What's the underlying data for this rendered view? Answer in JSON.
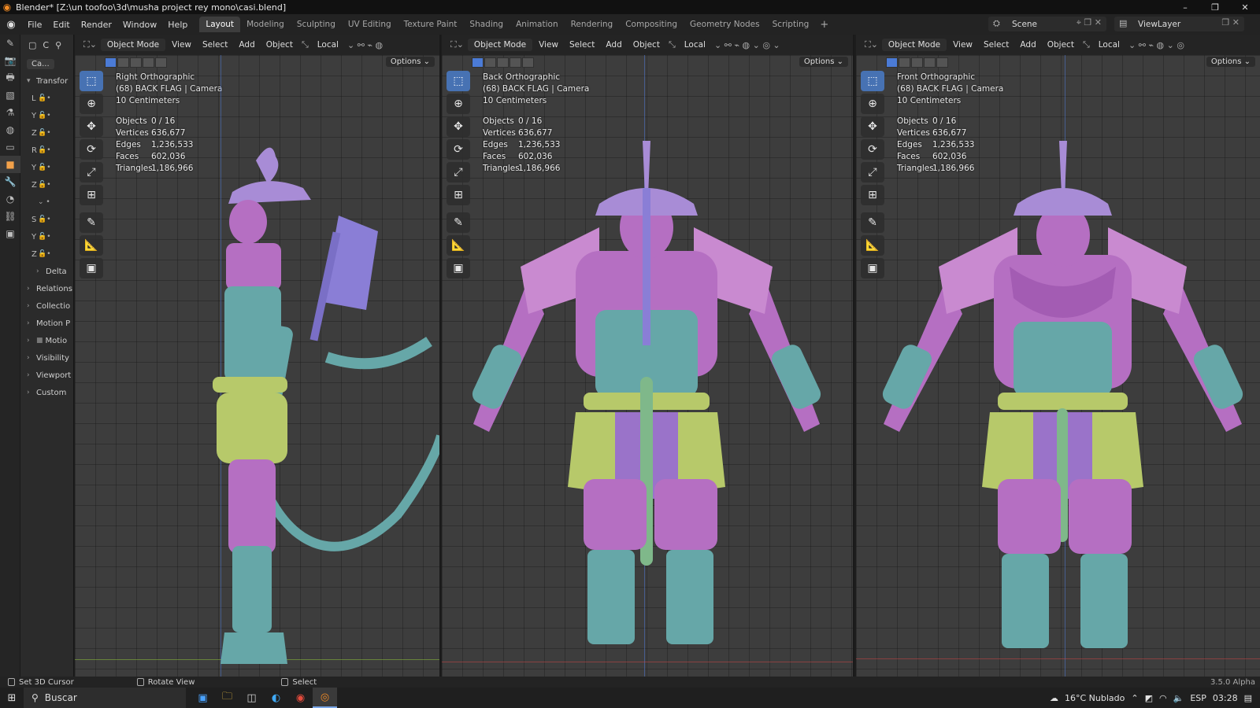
{
  "window": {
    "title": "Blender* [Z:\\un toofoo\\3d\\musha project rey mono\\casi.blend]",
    "controls": [
      "–",
      "❐",
      "✕"
    ]
  },
  "menu": {
    "items": [
      "File",
      "Edit",
      "Render",
      "Window",
      "Help"
    ],
    "workspaces": [
      "Layout",
      "Modeling",
      "Sculpting",
      "UV Editing",
      "Texture Paint",
      "Shading",
      "Animation",
      "Rendering",
      "Compositing",
      "Geometry Nodes",
      "Scripting"
    ],
    "active_workspace": "Layout",
    "add_label": "+"
  },
  "scene": {
    "label": "Scene"
  },
  "view_layer": {
    "label": "ViewLayer"
  },
  "properties": {
    "header_label": "C",
    "object_name": "Ca...",
    "transform_label": "Transfor",
    "location_axes": [
      "L",
      "Y",
      "Z"
    ],
    "rotation_axes": [
      "R",
      "Y",
      "Z"
    ],
    "scale_axes": [
      "S",
      "Y",
      "Z"
    ],
    "sections": [
      "Delta",
      "Relations",
      "Collectio",
      "Motion P",
      "Motio",
      "Visibility",
      "Viewport",
      "Custom"
    ]
  },
  "viewport_header": {
    "mode": "Object Mode",
    "menus": [
      "View",
      "Select",
      "Add",
      "Object"
    ],
    "orientation": "Local",
    "options": "Options"
  },
  "viewports": [
    {
      "view_name": "Right Orthographic",
      "collection": "(68) BACK FLAG | Camera",
      "scale": "10 Centimeters",
      "stats": {
        "objects": "0 / 16",
        "vertices": "636,677",
        "edges": "1,236,533",
        "faces": "602,036",
        "triangles": "1,186,966"
      }
    },
    {
      "view_name": "Back Orthographic",
      "collection": "(68) BACK FLAG | Camera",
      "scale": "10 Centimeters",
      "stats": {
        "objects": "0 / 16",
        "vertices": "636,677",
        "edges": "1,236,533",
        "faces": "602,036",
        "triangles": "1,186,966"
      }
    },
    {
      "view_name": "Front Orthographic",
      "collection": "(68) BACK FLAG | Camera",
      "scale": "10 Centimeters",
      "stats": {
        "objects": "0 / 16",
        "vertices": "636,677",
        "edges": "1,236,533",
        "faces": "602,036",
        "triangles": "1,186,966"
      }
    }
  ],
  "stat_labels": {
    "objects": "Objects",
    "vertices": "Vertices",
    "edges": "Edges",
    "faces": "Faces",
    "triangles": "Triangles"
  },
  "status": {
    "left": "Set 3D Cursor",
    "middle": "Rotate View",
    "right": "Select",
    "version": "3.5.0 Alpha"
  },
  "taskbar": {
    "search_placeholder": "Buscar",
    "weather": "16°C  Nublado",
    "language": "ESP",
    "time": "03:28"
  },
  "colors": {
    "armor_pink": "#b56fc2",
    "armor_teal": "#66a7a8",
    "sash_green": "#b7c96a",
    "helmet_purple": "#a88cd6",
    "accent_blue": "#4772b3"
  }
}
